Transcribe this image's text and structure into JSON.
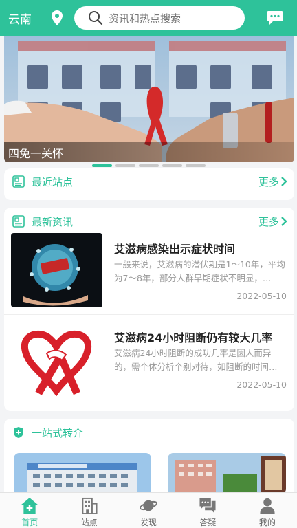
{
  "header": {
    "city": "云南",
    "search_placeholder": "资讯和热点搜索",
    "icons": [
      "location-pin-icon",
      "search-icon",
      "message-icon"
    ]
  },
  "banner": {
    "caption": "四免一关怀",
    "slide_count": 5,
    "active_slide": 1
  },
  "nearby": {
    "title": "最近站点",
    "more": "更多"
  },
  "news": {
    "title": "最新资讯",
    "more": "更多",
    "items": [
      {
        "title": "艾滋病感染出示症状时间",
        "summary": "一般来说，艾滋病的潜伏期是1～10年，平均为7～8年，部分人群早期症状不明显，…",
        "date": "2022-05-10"
      },
      {
        "title": "艾滋病24小时阻断仍有较大几率",
        "summary": "艾滋病24小时阻断的成功几率是因人而异的，需个体分析个别对待，如阻断的时间…",
        "date": "2022-05-10"
      }
    ]
  },
  "referral": {
    "title": "一站式转介"
  },
  "tabbar": {
    "items": [
      {
        "label": "首页",
        "icon": "home-icon",
        "active": true
      },
      {
        "label": "站点",
        "icon": "building-icon",
        "active": false
      },
      {
        "label": "发现",
        "icon": "planet-icon",
        "active": false
      },
      {
        "label": "答疑",
        "icon": "chat-bubbles-icon",
        "active": false
      },
      {
        "label": "我的",
        "icon": "user-icon",
        "active": false
      }
    ]
  },
  "colors": {
    "accent": "#2ec29a",
    "ribbon_red": "#d8202a"
  }
}
